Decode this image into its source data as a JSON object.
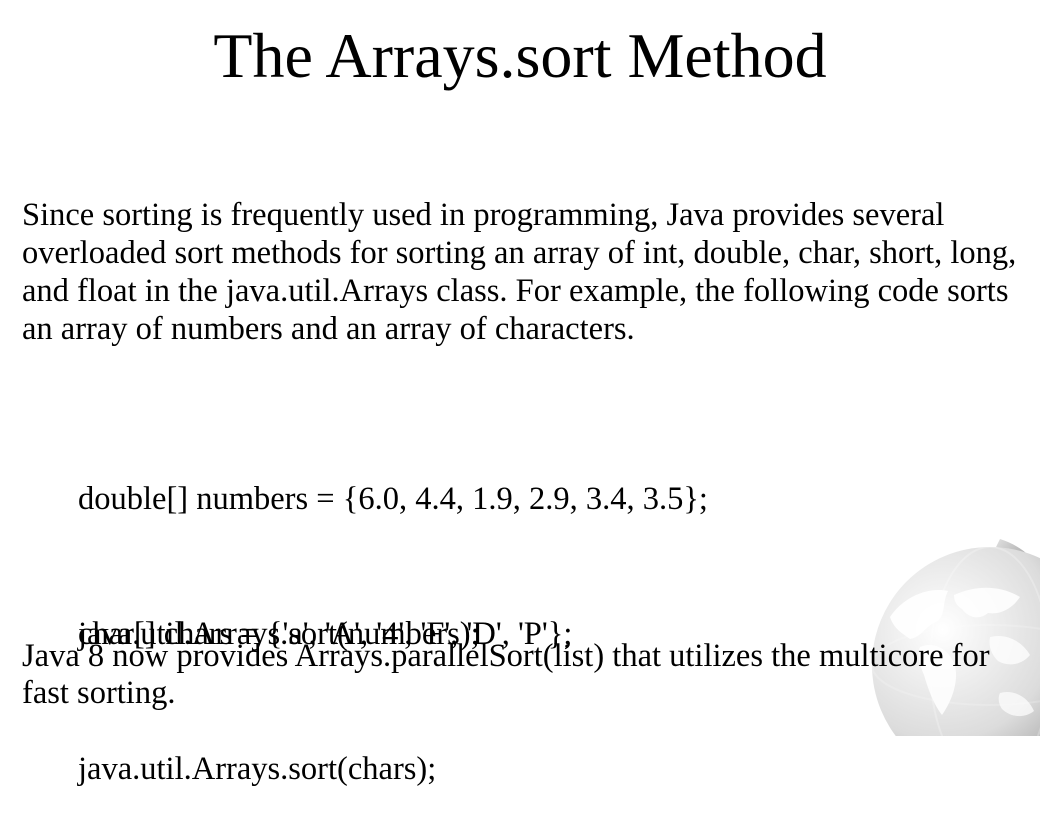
{
  "slide": {
    "title": "The Arrays.sort Method",
    "intro": "Since sorting is frequently used in programming, Java provides several overloaded sort methods for sorting an array of int, double, char, short, long, and float in the java.util.Arrays class. For example, the following code sorts an array of numbers and an array of characters.",
    "code_blocks": [
      {
        "lines": [
          "double[] numbers = {6.0, 4.4, 1.9, 2.9, 3.4, 3.5};",
          "java.util.Arrays.sort(numbers);"
        ]
      },
      {
        "lines": [
          "char[] chars = {'a', 'A', '4', 'F', 'D', 'P'};",
          "java.util.Arrays.sort(chars);"
        ]
      }
    ],
    "outro": "Java 8 now provides Arrays.parallelSort(list) that utilizes the multicore for fast sorting."
  },
  "decoration": {
    "icon": "globe-icon",
    "globe_colors": [
      "#9a9a9a",
      "#e6e6e6",
      "#ffffff"
    ]
  }
}
